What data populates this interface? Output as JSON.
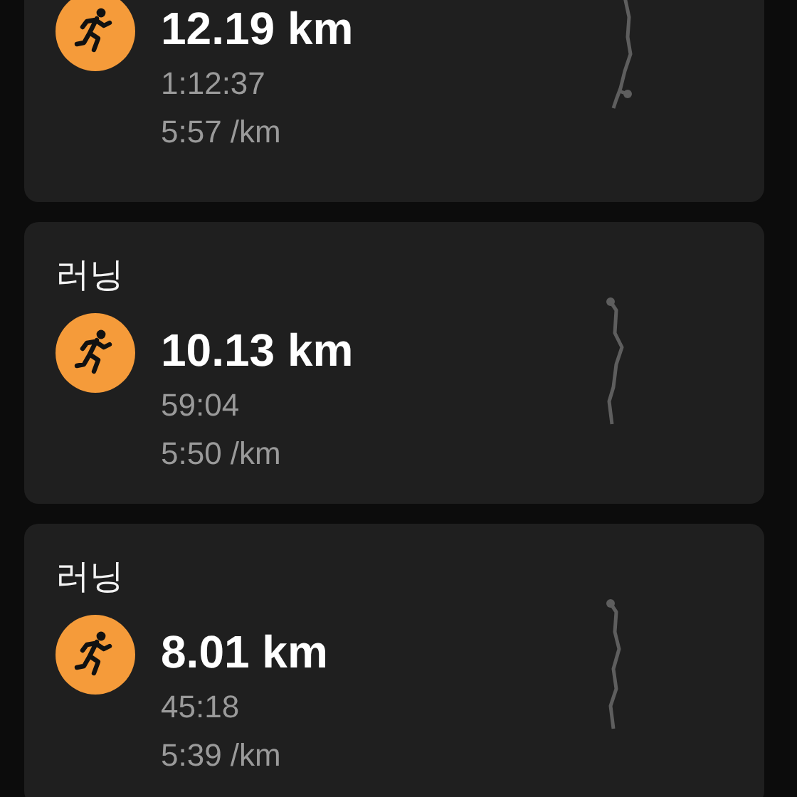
{
  "workouts": [
    {
      "distance": "12.19 km",
      "duration": "1:12:37",
      "pace": "5:57 /km"
    },
    {
      "title": "러닝",
      "distance": "10.13 km",
      "duration": "59:04",
      "pace": "5:50 /km"
    },
    {
      "title": "러닝",
      "distance": "8.01 km",
      "duration": "45:18",
      "pace": "5:39 /km"
    }
  ]
}
